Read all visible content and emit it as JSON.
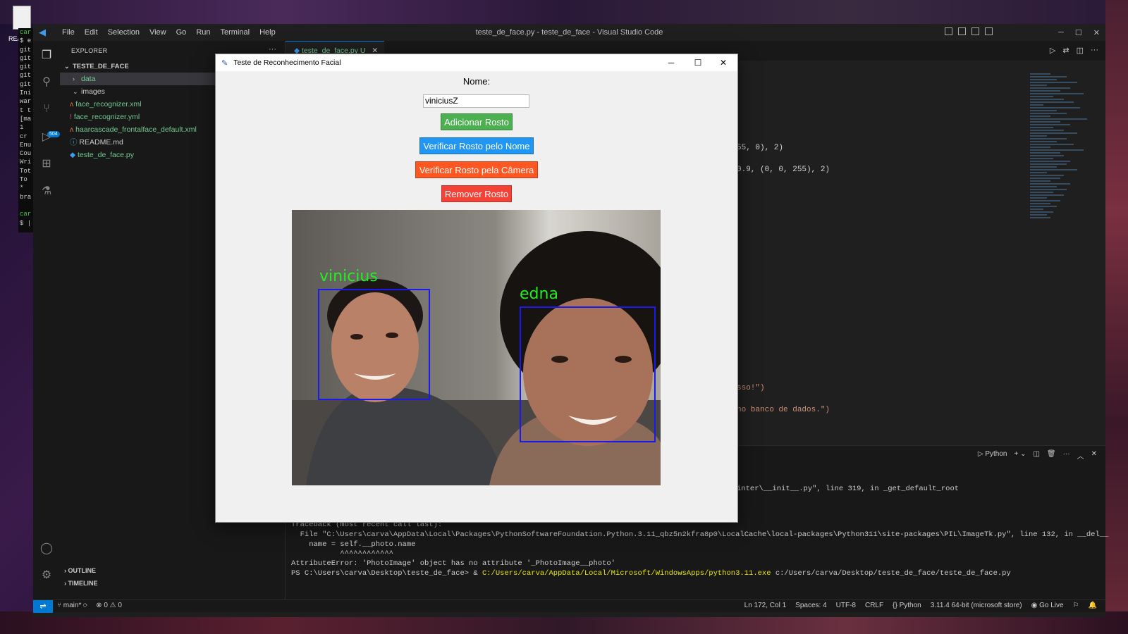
{
  "desktop": {
    "icon_label": "REA",
    "terminal_lines": [
      "car",
      "$ e",
      "git",
      "git",
      "git",
      "git",
      "git",
      "Ini",
      "war",
      "t t",
      "[ma",
      " 1",
      " cr",
      "Enu",
      "Cou",
      "Wri",
      "Tot",
      "To",
      " *",
      "bra",
      "",
      "car",
      "$ |"
    ]
  },
  "vscode": {
    "window_title": "teste_de_face.py - teste_de_face - Visual Studio Code",
    "menu": [
      "File",
      "Edit",
      "Selection",
      "View",
      "Go",
      "Run",
      "Terminal",
      "Help"
    ],
    "scm_badge": "504",
    "explorer": {
      "header": "EXPLORER",
      "more": "···",
      "root": "TESTE_DE_FACE",
      "items": [
        {
          "label": "data",
          "kind": "folder-collapsed"
        },
        {
          "label": "images",
          "kind": "folder-expanded"
        },
        {
          "label": "face_recognizer.xml",
          "kind": "xml"
        },
        {
          "label": "face_recognizer.yml",
          "kind": "yml"
        },
        {
          "label": "haarcascade_frontalface_default.xml",
          "kind": "xml"
        },
        {
          "label": "README.md",
          "kind": "md"
        },
        {
          "label": "teste_de_face.py",
          "kind": "py"
        }
      ],
      "outline": "OUTLINE",
      "timeline": "TIMELINE"
    },
    "tab": {
      "label": "teste_de_face.py",
      "status": "U",
      "close": "✕"
    },
    "code_fragments": [
      "55, 0), 2)",
      "0.9, (0, 0, 255), 2)",
      "sso!\")",
      "no banco de dados.\")"
    ],
    "terminal": {
      "panel_label": "Python",
      "lines": [
        "inter\\__init__.py\", line 319, in _get_default_root",
        "Traceback (most recent call last):",
        "  File \"C:\\Users\\carva\\AppData\\Local\\Packages\\PythonSoftwareFoundation.Python.3.11_qbz5n2kfra8p0\\LocalCache\\local-packages\\Python311\\site-packages\\PIL\\ImageTk.py\", line 132, in __del__",
        "    name = self.__photo.name",
        "           ^^^^^^^^^^^^",
        "AttributeError: 'PhotoImage' object has no attribute '_PhotoImage__photo'"
      ],
      "prompt": "PS C:\\Users\\carva\\Desktop\\teste_de_face> & ",
      "exe": "C:/Users/carva/AppData/Local/Microsoft/WindowsApps/python3.11.exe",
      "script": " c:/Users/carva/Desktop/teste_de_face/teste_de_face.py"
    },
    "status": {
      "branch": "main*",
      "errors": "0",
      "warnings": "0",
      "position": "Ln 172, Col 1",
      "spaces": "Spaces: 4",
      "encoding": "UTF-8",
      "eol": "CRLF",
      "language": "Python",
      "interpreter": "3.11.4 64-bit (microsoft store)",
      "golive": "Go Live"
    }
  },
  "dialog": {
    "title": "Teste de Reconhecimento Facial",
    "name_label": "Nome:",
    "name_value": "viniciusZ",
    "buttons": {
      "add": "Adicionar Rosto",
      "verify_name": "Verificar Rosto pelo Nome",
      "verify_camera": "Verificar Rosto pela Câmera",
      "remove": "Remover Rosto"
    },
    "faces": [
      {
        "name": "vinicius"
      },
      {
        "name": "edna"
      }
    ]
  },
  "colors": {
    "add": "#4caf50",
    "verify_name": "#2196f3",
    "verify_camera": "#ff5722",
    "remove": "#f44336",
    "face_label": "#22ee22",
    "face_box": "#1a1aee",
    "accent": "#0078d4"
  }
}
